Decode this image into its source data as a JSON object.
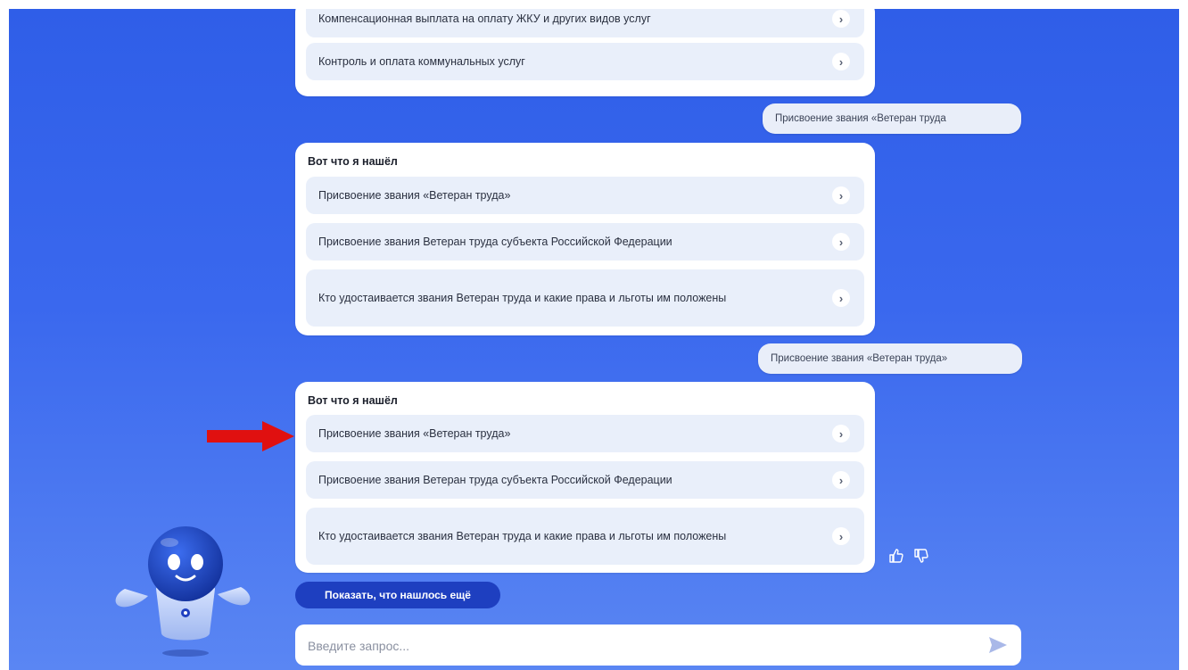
{
  "first_card": {
    "items": [
      {
        "label": "Компенсационная выплата на оплату ЖКУ и других видов услуг"
      },
      {
        "label": "Контроль и оплата коммунальных услуг"
      }
    ]
  },
  "user_messages": [
    {
      "text": "Присвоение звания «Ветеран труда"
    },
    {
      "text": "Присвоение звания «Ветеран труда»"
    }
  ],
  "result_cards": [
    {
      "title": "Вот что я нашёл",
      "items": [
        {
          "label": "Присвоение звания «Ветеран труда»"
        },
        {
          "label": "Присвоение звания Ветеран труда субъекта Российской Федерации"
        },
        {
          "label": "Кто удостаивается звания Ветеран труда и какие права и льготы им положены"
        }
      ]
    },
    {
      "title": "Вот что я нашёл",
      "items": [
        {
          "label": "Присвоение звания «Ветеран труда»"
        },
        {
          "label": "Присвоение звания Ветеран труда субъекта Российской Федерации"
        },
        {
          "label": "Кто удостаивается звания Ветеран труда и какие права и льготы им положены"
        }
      ]
    }
  ],
  "show_more_label": "Показать, что нашлось ещё",
  "input": {
    "value": "",
    "placeholder": "Введите запрос..."
  },
  "icons": {
    "chevron": "chevron-right-icon",
    "send": "send-icon",
    "like": "thumbs-up-icon",
    "dislike": "thumbs-down-icon",
    "annotation": "red-arrow-icon",
    "assistant": "robot-assistant-icon"
  },
  "colors": {
    "background_top": "#2f5ee8",
    "background_bottom": "#5a86f3",
    "item_background": "#e9effa",
    "button": "#1e3fc0",
    "annotation_arrow": "#e01010"
  }
}
